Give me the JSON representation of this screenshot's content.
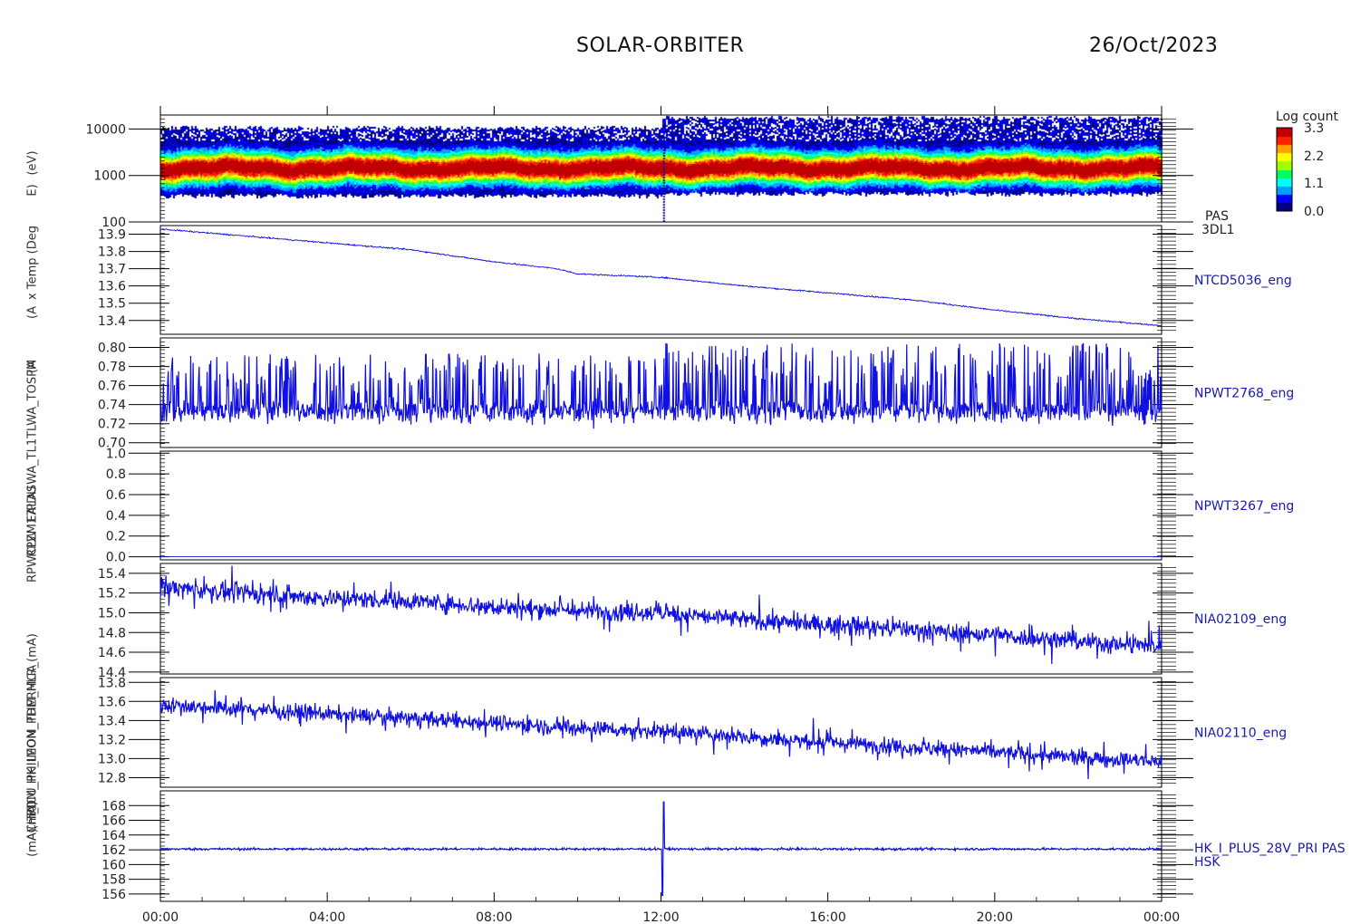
{
  "header": {
    "mission": "SOLAR-ORBITER",
    "date": "26/Oct/2023"
  },
  "colorbar": {
    "title": "Log count",
    "ticks": [
      "3.3",
      "2.2",
      "1.1",
      "0.0"
    ],
    "colors": [
      "#000080",
      "#0000ff",
      "#00a0ff",
      "#00ffff",
      "#00ff60",
      "#a0ff00",
      "#ffff00",
      "#ffa000",
      "#ff2000",
      "#c00000"
    ]
  },
  "y_titles": [
    "(eV)",
    "E)",
    "x Temp (Deg",
    "(A",
    "(A",
    "SWA_TL1TLWA_TOSPM",
    "PDU",
    "ZM17",
    "EALA",
    "RPW",
    "RPWCL",
    "(mA)",
    "T_ICU_PHILEOM_THERMCA",
    "PDM_HK_IMON_PDM_HLR_(mA)",
    "ACHK",
    "(mA)"
  ],
  "chart_data": [
    {
      "type": "heatmap",
      "name_label": [
        "PAS",
        "3DL1"
      ],
      "y_scale": "log",
      "ylim": [
        100,
        20000
      ],
      "yticks": [
        "10000",
        "1000",
        "100"
      ],
      "ytick_values": [
        10000,
        1000,
        100
      ],
      "color_range": [
        0.0,
        3.3
      ],
      "band": {
        "peak_energy_eV": 1500,
        "min_energy_eV": [
          380,
          420
        ],
        "max_energy_eV": [
          11000,
          18000
        ],
        "enhanced_after": "12:00"
      }
    },
    {
      "type": "line",
      "label": "NTCD5036_eng",
      "ylim": [
        13.32,
        13.95
      ],
      "yticks": [
        "13.9",
        "13.8",
        "13.7",
        "13.6",
        "13.5",
        "13.4"
      ],
      "ytick_values": [
        13.9,
        13.8,
        13.7,
        13.6,
        13.5,
        13.4
      ],
      "x_hours": [
        0,
        1,
        2,
        3,
        4,
        6,
        8,
        9.5,
        10,
        12,
        14,
        16,
        18,
        20,
        22,
        24
      ],
      "values": [
        13.93,
        13.91,
        13.89,
        13.87,
        13.85,
        13.81,
        13.74,
        13.7,
        13.67,
        13.65,
        13.6,
        13.56,
        13.52,
        13.46,
        13.41,
        13.37
      ],
      "noise": 0.004
    },
    {
      "type": "line",
      "label": "NPWT2768_eng",
      "ylim": [
        0.695,
        0.81
      ],
      "yticks": [
        "0.80",
        "0.78",
        "0.76",
        "0.74",
        "0.72",
        "0.70"
      ],
      "ytick_values": [
        0.8,
        0.78,
        0.76,
        0.74,
        0.72,
        0.7
      ],
      "x_hours": [
        0,
        24
      ],
      "values": [
        0.733,
        0.733
      ],
      "noise": 0.012,
      "spike_max": 0.805,
      "spike_min": 0.712
    },
    {
      "type": "line",
      "label": "NPWT3267_eng",
      "ylim": [
        -0.03,
        1.02
      ],
      "yticks": [
        "1.0",
        "0.8",
        "0.6",
        "0.4",
        "0.2",
        "0.0"
      ],
      "ytick_values": [
        1.0,
        0.8,
        0.6,
        0.4,
        0.2,
        0.0
      ],
      "x_hours": [
        0,
        24
      ],
      "values": [
        0.0,
        0.0
      ],
      "noise": 0.0
    },
    {
      "type": "line",
      "label": "NIA02109_eng",
      "ylim": [
        14.38,
        15.5
      ],
      "yticks": [
        "15.4",
        "15.2",
        "15.0",
        "14.8",
        "14.6",
        "14.4"
      ],
      "ytick_values": [
        15.4,
        15.2,
        15.0,
        14.8,
        14.6,
        14.4
      ],
      "x_hours": [
        0,
        2,
        4,
        6,
        8,
        10,
        12,
        14,
        16,
        18,
        20,
        22,
        24
      ],
      "values": [
        15.26,
        15.2,
        15.15,
        15.12,
        15.06,
        15.02,
        15.0,
        14.93,
        14.88,
        14.83,
        14.77,
        14.71,
        14.66
      ],
      "noise": 0.09
    },
    {
      "type": "line",
      "label": "NIA02110_eng",
      "ylim": [
        12.7,
        13.85
      ],
      "yticks": [
        "13.8",
        "13.6",
        "13.4",
        "13.2",
        "13.0",
        "12.8"
      ],
      "ytick_values": [
        13.8,
        13.6,
        13.4,
        13.2,
        13.0,
        12.8
      ],
      "x_hours": [
        0,
        2,
        4,
        6,
        8,
        10,
        12,
        14,
        16,
        18,
        20,
        22,
        24
      ],
      "values": [
        13.57,
        13.52,
        13.47,
        13.42,
        13.38,
        13.32,
        13.29,
        13.23,
        13.17,
        13.12,
        13.07,
        13.01,
        12.97
      ],
      "noise": 0.08
    },
    {
      "type": "line",
      "label": [
        "HK_I_PLUS_28V_PRI PAS",
        "HSK"
      ],
      "ylim": [
        155,
        170
      ],
      "yticks": [
        "168",
        "166",
        "164",
        "162",
        "160",
        "158",
        "156"
      ],
      "ytick_values": [
        168,
        166,
        164,
        162,
        160,
        158,
        156
      ],
      "x_hours": [
        0,
        24
      ],
      "values": [
        162.1,
        162.1
      ],
      "noise": 0.15,
      "event": {
        "hour": 12.05,
        "max": 168.5,
        "min": 155.8
      }
    }
  ],
  "xaxis": {
    "ticks": [
      "00:00",
      "04:00",
      "08:00",
      "12:00",
      "16:00",
      "20:00",
      "00:00"
    ],
    "tick_hours": [
      0,
      4,
      8,
      12,
      16,
      20,
      24
    ]
  }
}
